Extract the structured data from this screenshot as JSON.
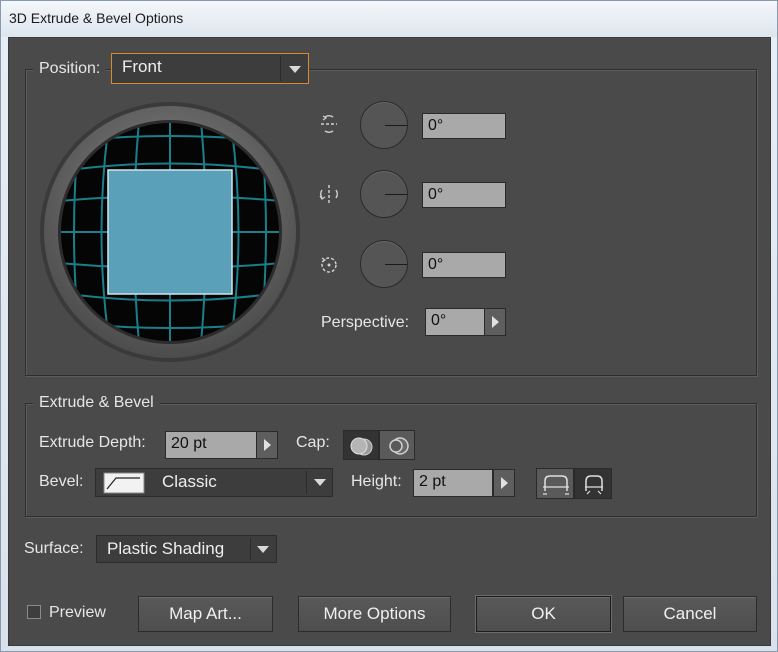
{
  "window": {
    "title": "3D Extrude & Bevel Options"
  },
  "position": {
    "label": "Position:",
    "preset": "Front",
    "x_angle": "0°",
    "y_angle": "0°",
    "z_angle": "0°",
    "perspective_label": "Perspective:",
    "perspective": "0°",
    "cube_face_color": "#5aa0b8",
    "grid_color": "#1a7f8a"
  },
  "extrude": {
    "group_title": "Extrude & Bevel",
    "depth_label": "Extrude Depth:",
    "depth": "20 pt",
    "cap_label": "Cap:",
    "bevel_label": "Bevel:",
    "bevel": "Classic",
    "height_label": "Height:",
    "height": "2 pt"
  },
  "surface": {
    "label": "Surface:",
    "value": "Plastic Shading"
  },
  "footer": {
    "preview_label": "Preview",
    "map_art_label": "Map Art...",
    "more_options_label": "More Options",
    "ok_label": "OK",
    "cancel_label": "Cancel"
  }
}
